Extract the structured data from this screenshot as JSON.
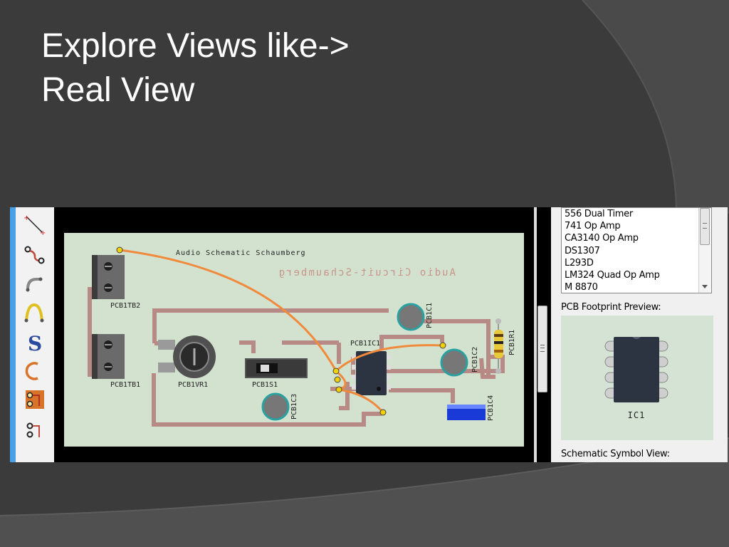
{
  "slide": {
    "title_line1": "Explore Views like->",
    "title_line2": "Real View"
  },
  "toolbar": {
    "tools": [
      {
        "icon": "line-tool-icon"
      },
      {
        "icon": "wire-tool-icon"
      },
      {
        "icon": "bend-wire-icon"
      },
      {
        "icon": "jumper-wire-icon"
      },
      {
        "icon": "s-curve-icon"
      },
      {
        "icon": "arc-tool-icon"
      },
      {
        "icon": "pad-trace-icon"
      },
      {
        "icon": "pad-wire-icon"
      }
    ]
  },
  "board": {
    "title_text": "Audio Schematic Schaumberg",
    "mirrored_text": "Audio Circuit-Schaumberg",
    "components": {
      "tb2": "PCB1TB2",
      "tb1": "PCB1TB1",
      "vr1": "PCB1VR1",
      "s1": "PCB1S1",
      "ic1": "PCB1IC1",
      "c1": "PCB1C1",
      "c2": "PCB1C2",
      "c3": "PCB1C3",
      "c4": "PCB1C4",
      "r1": "PCB1R1"
    },
    "colors": {
      "board": "#d3e1cf",
      "trace": "#b88a86",
      "ratsnest": "#f08a3c"
    }
  },
  "parts_panel": {
    "items": [
      "556 Dual Timer",
      "741 Op Amp",
      "CA3140 Op Amp",
      "DS1307",
      "L293D",
      "LM324 Quad Op Amp",
      "M 8870"
    ],
    "footprint_label": "PCB Footprint Preview:",
    "footprint_part": "IC1",
    "schematic_label": "Schematic Symbol View:"
  }
}
